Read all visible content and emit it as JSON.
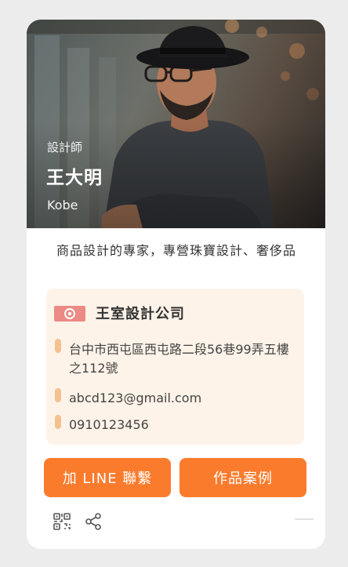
{
  "profile": {
    "title": "設計師",
    "name": "王大明",
    "english_name": "Kobe",
    "intro": "商品設計的專家，專營珠寶設計、奢侈品"
  },
  "company": {
    "name": "王室設計公司",
    "logo_color": "#ec8a86",
    "address": "台中市西屯區西屯路二段56巷99弄五樓之112號",
    "email": "abcd123@gmail.com",
    "phone": "0910123456"
  },
  "actions": {
    "line_label": "加 LINE 聯繫",
    "works_label": "作品案例"
  },
  "icons": {
    "qr": "qr-code-icon",
    "share": "share-icon"
  },
  "colors": {
    "accent": "#fb7b2d",
    "panel": "#fdf3e8",
    "marker": "#f4c191",
    "background": "#ececec"
  }
}
